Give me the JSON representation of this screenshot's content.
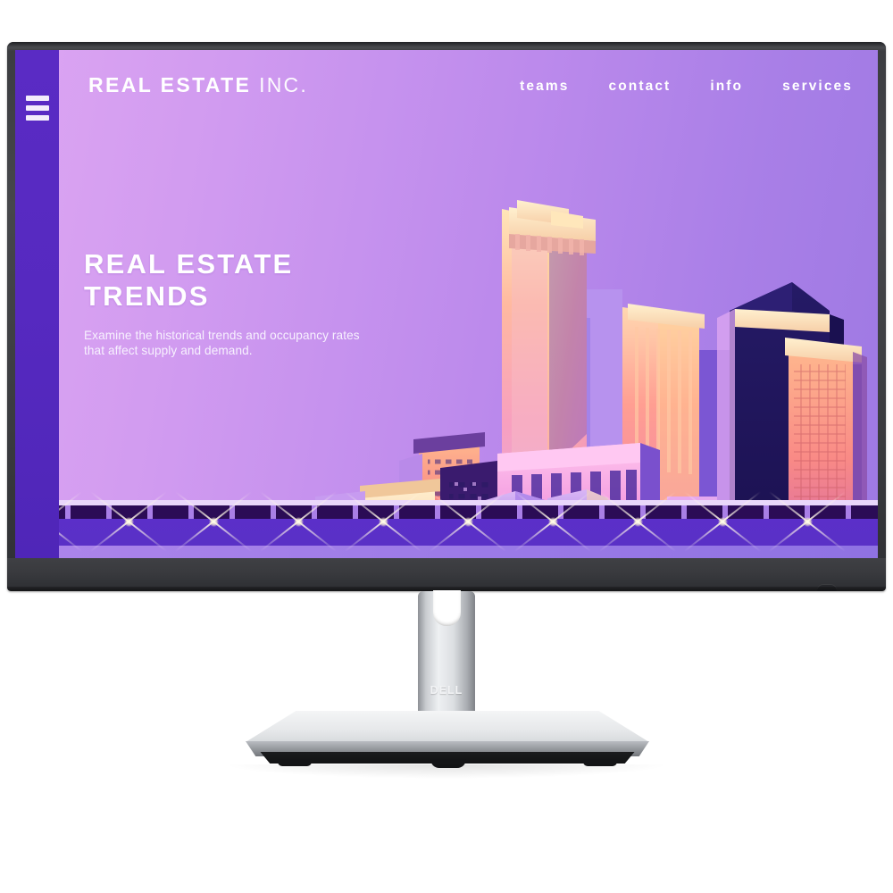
{
  "device": {
    "brand_label": "DELL",
    "type": "monitor"
  },
  "website": {
    "menu_icon": "hamburger-menu-icon",
    "brand": {
      "primary": "REAL ESTATE",
      "secondary": "INC."
    },
    "nav": [
      {
        "label": "teams"
      },
      {
        "label": "contact"
      },
      {
        "label": "info"
      },
      {
        "label": "services"
      }
    ],
    "hero": {
      "headline": "REAL ESTATE\nTRENDS",
      "subtext": "Examine the historical trends and occupancy rates that affect supply and demand."
    },
    "illustration": {
      "name": "city-skyline-illustration",
      "description": "Stylized purple and pink gradient cityscape with skyscrapers at sunset"
    },
    "colors": {
      "background_left": "#dca5f2",
      "background_right": "#9e79e3",
      "sidebar": "#5629c0",
      "ground_band": "#5b2fc9",
      "rail_dark": "#2b0c56",
      "highlight": "#e9d7fb",
      "text": "#ffffff"
    }
  }
}
